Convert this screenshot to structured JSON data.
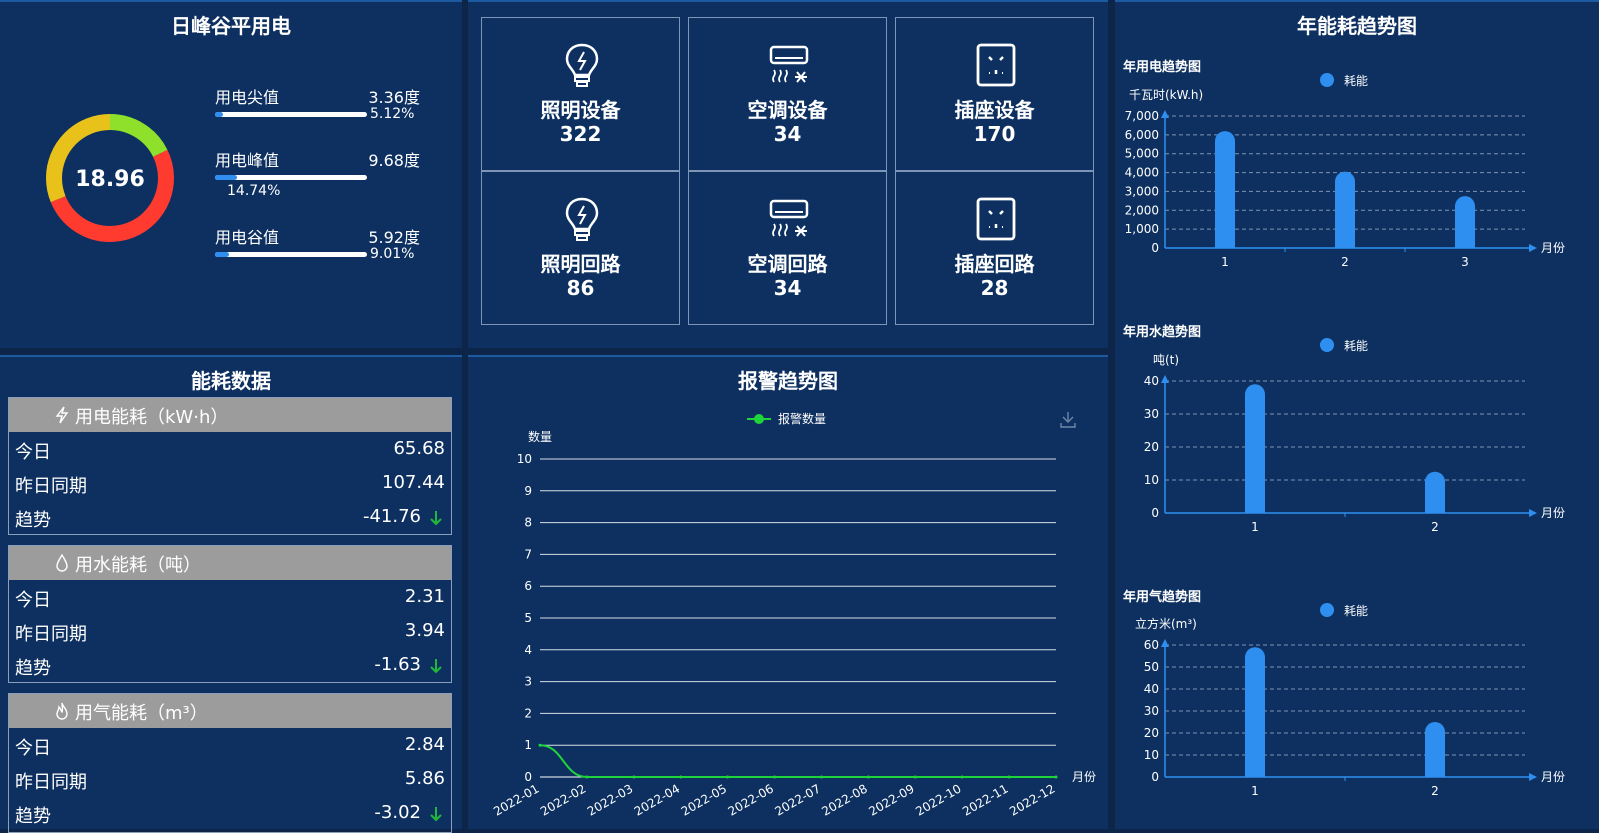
{
  "peak_valley": {
    "title": "日峰谷平用电",
    "total": "18.96",
    "items": [
      {
        "name": "用电尖值",
        "value": "3.36度",
        "percent": "5.12%",
        "fraction": 0.0512,
        "color": "#8fe02a"
      },
      {
        "name": "用电峰值",
        "value": "9.68度",
        "percent": "14.74%",
        "fraction": 0.1474,
        "color": "#ff3b30"
      },
      {
        "name": "用电谷值",
        "value": "5.92度",
        "percent": "9.01%",
        "fraction": 0.0901,
        "color": "#e8c21b"
      }
    ],
    "donut_shares": [
      3.36,
      9.68,
      5.92
    ]
  },
  "devices": [
    {
      "label": "照明设备",
      "value": "322",
      "icon": "lightbulb-icon"
    },
    {
      "label": "空调设备",
      "value": "34",
      "icon": "air-conditioner-icon"
    },
    {
      "label": "插座设备",
      "value": "170",
      "icon": "socket-icon"
    },
    {
      "label": "照明回路",
      "value": "86",
      "icon": "lightbulb-icon"
    },
    {
      "label": "空调回路",
      "value": "34",
      "icon": "air-conditioner-icon"
    },
    {
      "label": "插座回路",
      "value": "28",
      "icon": "socket-icon"
    }
  ],
  "energy_data": {
    "title": "能耗数据",
    "blocks": [
      {
        "header": "用电能耗（kW·h）",
        "icon": "lightning-icon",
        "rows": [
          {
            "k": "今日",
            "v": "65.68"
          },
          {
            "k": "昨日同期",
            "v": "107.44"
          },
          {
            "k": "趋势",
            "v": "-41.76"
          }
        ]
      },
      {
        "header": "用水能耗（吨）",
        "icon": "water-drop-icon",
        "rows": [
          {
            "k": "今日",
            "v": "2.31"
          },
          {
            "k": "昨日同期",
            "v": "3.94"
          },
          {
            "k": "趋势",
            "v": "-1.63"
          }
        ]
      },
      {
        "header": "用气能耗（m³）",
        "icon": "flame-icon",
        "rows": [
          {
            "k": "今日",
            "v": "2.84"
          },
          {
            "k": "昨日同期",
            "v": "5.86"
          },
          {
            "k": "趋势",
            "v": "-3.02"
          }
        ]
      }
    ]
  },
  "alarm": {
    "title": "报警趋势图"
  },
  "annual": {
    "title": "年能耗趋势图"
  },
  "chart_data": [
    {
      "type": "line",
      "title": "报警趋势图",
      "legend": [
        "报警数量"
      ],
      "ylabel": "数量",
      "xlabel": "月份",
      "ylim": [
        0,
        10
      ],
      "yticks": [
        0,
        1,
        2,
        3,
        4,
        5,
        6,
        7,
        8,
        9,
        10
      ],
      "x": [
        "2022-01",
        "2022-02",
        "2022-03",
        "2022-04",
        "2022-05",
        "2022-06",
        "2022-07",
        "2022-08",
        "2022-09",
        "2022-10",
        "2022-11",
        "2022-12"
      ],
      "series": [
        {
          "name": "报警数量",
          "values": [
            1,
            0,
            0,
            0,
            0,
            0,
            0,
            0,
            0,
            0,
            0,
            0
          ],
          "color": "#1fd43b"
        }
      ]
    },
    {
      "type": "bar",
      "title": "年用电趋势图",
      "legend": [
        "耗能"
      ],
      "ylabel": "千瓦时(kW.h)",
      "xlabel": "月份",
      "ylim": [
        0,
        7000
      ],
      "yticks": [
        "0",
        "1,000",
        "2,000",
        "3,000",
        "4,000",
        "5,000",
        "6,000",
        "7,000"
      ],
      "categories": [
        "1",
        "2",
        "3"
      ],
      "series": [
        {
          "name": "耗能",
          "values": [
            6200,
            4050,
            2750
          ],
          "color": "#2e8ff0"
        }
      ]
    },
    {
      "type": "bar",
      "title": "年用水趋势图",
      "legend": [
        "耗能"
      ],
      "ylabel": "吨(t)",
      "xlabel": "月份",
      "ylim": [
        0,
        40
      ],
      "yticks": [
        "0",
        "10",
        "20",
        "30",
        "40"
      ],
      "categories": [
        "1",
        "2"
      ],
      "series": [
        {
          "name": "耗能",
          "values": [
            39,
            12.5
          ],
          "color": "#2e8ff0"
        }
      ]
    },
    {
      "type": "bar",
      "title": "年用气趋势图",
      "legend": [
        "耗能"
      ],
      "ylabel": "立方米(m³)",
      "xlabel": "月份",
      "ylim": [
        0,
        60
      ],
      "yticks": [
        "0",
        "10",
        "20",
        "30",
        "40",
        "50",
        "60"
      ],
      "categories": [
        "1",
        "2"
      ],
      "series": [
        {
          "name": "耗能",
          "values": [
            59,
            25
          ],
          "color": "#2e8ff0"
        }
      ]
    }
  ]
}
